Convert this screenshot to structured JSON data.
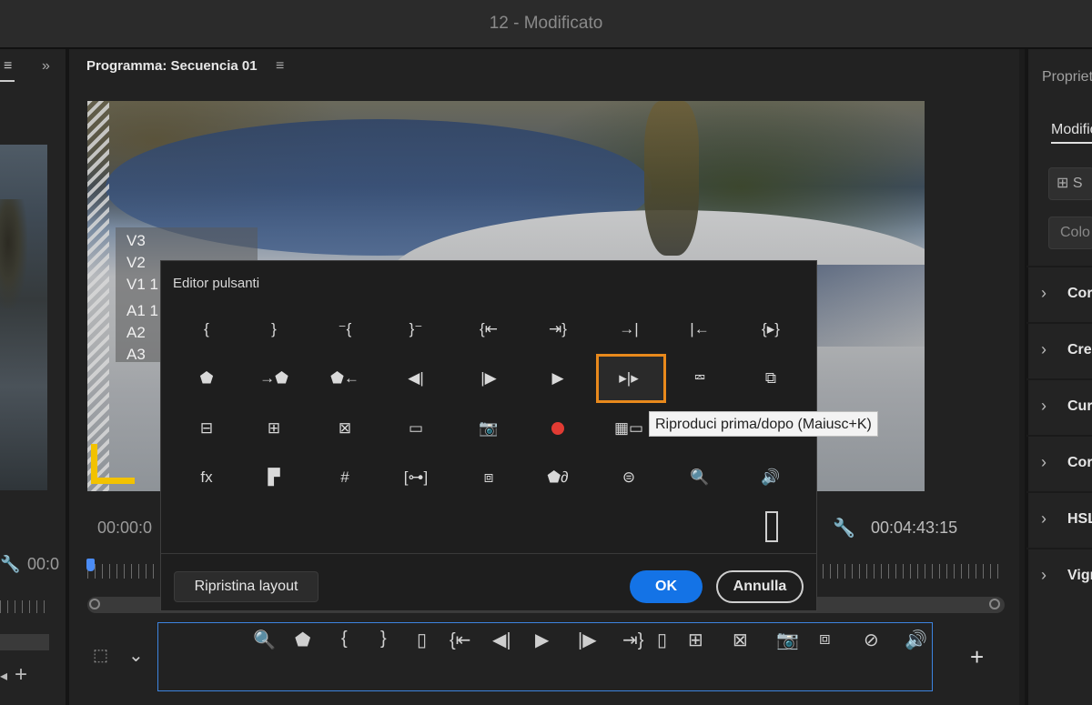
{
  "window": {
    "title": "12 - Modificato"
  },
  "left_panel": {
    "hamburger": "≡",
    "expand": "»",
    "timecode": "00:0",
    "plus": "+",
    "arrow": "◂"
  },
  "program": {
    "title": "Programma: Secuencia 01",
    "menu": "≡",
    "tracks": [
      "V3",
      "V2",
      "V1 1",
      "A1 1",
      "A2",
      "A3"
    ],
    "timecode_left": "00:00:0",
    "timecode_right": "00:04:43:15",
    "wrench": "🔧"
  },
  "dialog": {
    "title": "Editor pulsanti",
    "buttons": [
      {
        "name": "mark-in-icon",
        "glyph": "{"
      },
      {
        "name": "mark-out-icon",
        "glyph": "}"
      },
      {
        "name": "mark-clip-in-icon",
        "glyph": "⁻{"
      },
      {
        "name": "mark-clip-out-icon",
        "glyph": "}⁻"
      },
      {
        "name": "go-to-in-icon",
        "glyph": "{⇤"
      },
      {
        "name": "go-to-out-icon",
        "glyph": "⇥}"
      },
      {
        "name": "go-to-next-edit-icon",
        "glyph": "→|"
      },
      {
        "name": "go-to-previous-edit-icon",
        "glyph": "|←"
      },
      {
        "name": "play-in-to-out-icon",
        "glyph": "{▸}"
      },
      {
        "name": "add-marker-icon",
        "glyph": "⬟"
      },
      {
        "name": "go-to-next-marker-icon",
        "glyph": "→⬟"
      },
      {
        "name": "go-to-previous-marker-icon",
        "glyph": "⬟←"
      },
      {
        "name": "step-back-icon",
        "glyph": "◀|"
      },
      {
        "name": "step-forward-icon",
        "glyph": "|▶"
      },
      {
        "name": "play-icon",
        "glyph": "▶"
      },
      {
        "name": "play-before-after-icon",
        "glyph": "▸|▸"
      },
      {
        "name": "loop-playback-icon",
        "glyph": "⮹"
      },
      {
        "name": "trim-monitor-icon",
        "glyph": "⧉"
      },
      {
        "name": "insert-icon",
        "glyph": "⊟"
      },
      {
        "name": "lift-icon",
        "glyph": "⊞"
      },
      {
        "name": "extract-icon",
        "glyph": "⊠"
      },
      {
        "name": "safe-margins-icon",
        "glyph": "▭"
      },
      {
        "name": "export-frame-icon",
        "glyph": "📷"
      },
      {
        "name": "record-icon",
        "glyph": "●"
      },
      {
        "name": "multicam-icon",
        "glyph": "▦▭"
      },
      {
        "name": "proxy-toggle-icon",
        "glyph": ""
      },
      {
        "name": "comparison-view-icon",
        "glyph": ""
      },
      {
        "name": "effects-icon",
        "glyph": "fx"
      },
      {
        "name": "film-strip-icon",
        "glyph": "▛"
      },
      {
        "name": "grid-icon",
        "glyph": "#"
      },
      {
        "name": "match-frame-icon",
        "glyph": "[⊶]"
      },
      {
        "name": "proxies-icon",
        "glyph": "⧈"
      },
      {
        "name": "link-marker-icon",
        "glyph": "⬟∂"
      },
      {
        "name": "vr-video-icon",
        "glyph": "⊜"
      },
      {
        "name": "magnify-icon",
        "glyph": "🔍"
      },
      {
        "name": "volume-icon",
        "glyph": "🔊"
      }
    ],
    "tooltip": "Riproduci prima/dopo (Maiusc+K)",
    "reset_button": "Ripristina layout",
    "ok_button": "OK",
    "cancel_button": "Annulla"
  },
  "button_bar": {
    "settings_icon": "⬚",
    "chevron": "⌄",
    "plus": "+",
    "buttons": [
      {
        "name": "magnify-icon",
        "glyph": "🔍"
      },
      {
        "name": "add-marker-icon",
        "glyph": "⬟"
      },
      {
        "name": "mark-in-icon",
        "glyph": "{"
      },
      {
        "name": "mark-out-icon",
        "glyph": "}"
      },
      {
        "name": "spacer-icon",
        "glyph": "▯"
      },
      {
        "name": "go-to-in-icon",
        "glyph": "{⇤"
      },
      {
        "name": "step-back-icon",
        "glyph": "◀|"
      },
      {
        "name": "play-icon",
        "glyph": "▶"
      },
      {
        "name": "step-forward-icon",
        "glyph": "|▶"
      },
      {
        "name": "go-to-out-icon",
        "glyph": "⇥}"
      },
      {
        "name": "spacer-icon",
        "glyph": "▯"
      },
      {
        "name": "lift-icon",
        "glyph": "⊞"
      },
      {
        "name": "extract-icon",
        "glyph": "⊠"
      },
      {
        "name": "export-frame-icon",
        "glyph": "📷"
      },
      {
        "name": "proxies-icon",
        "glyph": "⧈"
      },
      {
        "name": "vr-off-icon",
        "glyph": "⊘"
      },
      {
        "name": "volume-icon",
        "glyph": "🔊"
      }
    ]
  },
  "right_panel": {
    "title": "Propriet",
    "tab": "Modific",
    "btn1": "⊞ S",
    "btn2": "Colo",
    "sections": [
      "Cor",
      "Crea",
      "Cur",
      "Cor",
      "HSL",
      "Vign"
    ],
    "chevron": "›"
  },
  "colors": {
    "accent_blue": "#1473e6",
    "highlight_orange": "#e8891c",
    "record_red": "#e13b33",
    "corner_yellow": "#f2c200"
  }
}
